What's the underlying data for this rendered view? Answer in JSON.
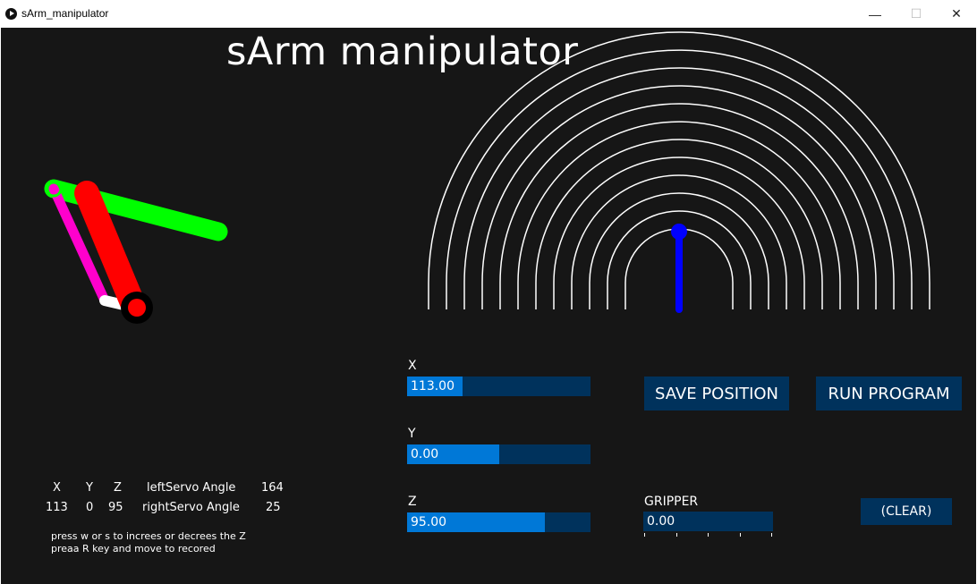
{
  "window": {
    "title": "sArm_manipulator",
    "minimize": "—",
    "maximize": "☐",
    "close": "✕"
  },
  "app": {
    "title": "sArm manipulator"
  },
  "sliders": {
    "x": {
      "label": "X",
      "value": "113.00",
      "fraction": 0.3
    },
    "y": {
      "label": "Y",
      "value": "0.00",
      "fraction": 0.5
    },
    "z": {
      "label": "Z",
      "value": "95.00",
      "fraction": 0.75
    },
    "gripper": {
      "label": "GRIPPER",
      "value": "0.00",
      "fraction": 0.0
    }
  },
  "buttons": {
    "save": "SAVE POSITION",
    "run": "RUN PROGRAM",
    "clear": "(CLEAR)"
  },
  "readout": {
    "x_header": "X",
    "y_header": "Y",
    "z_header": "Z",
    "x_value": "113",
    "y_value": "0",
    "z_value": "95",
    "left_label": "leftServo Angle",
    "left_value": "164",
    "right_label": "rightServo Angle",
    "right_value": "25"
  },
  "hints": {
    "line1": "press w or s to increes or decrees the Z",
    "line2": "preaa R key and move to recored"
  },
  "colors": {
    "background": "#161616",
    "slider_bg": "#00325c",
    "slider_fill": "#0078d7",
    "arm_green": "#00ff00",
    "arm_red": "#ff0000",
    "arm_magenta": "#ff00cc",
    "base_arm": "#0000ff",
    "arcs": "#ffffff"
  }
}
